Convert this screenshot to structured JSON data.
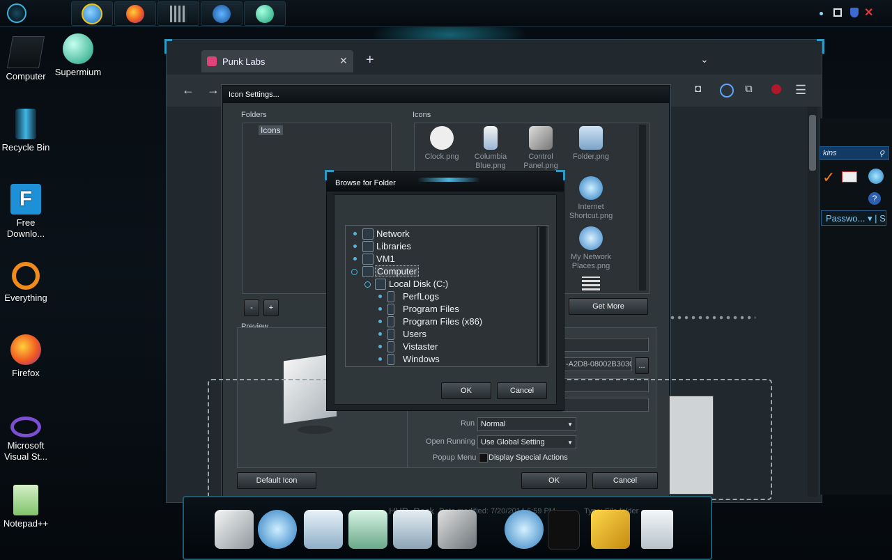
{
  "taskbar": {
    "apps": [
      "internet-explorer",
      "firefox",
      "film-strip",
      "media-player",
      "supermium"
    ],
    "tray_icons": [
      "restore-icon",
      "shield-icon",
      "close-icon"
    ]
  },
  "desktop": {
    "icons": [
      {
        "label": "Computer",
        "icon": "computer-icon"
      },
      {
        "label": "Supermium",
        "icon": "supermium-icon"
      },
      {
        "label": "Recycle Bin",
        "icon": "recycle-bin-icon"
      },
      {
        "label": "Free Downlo...",
        "icon": "free-download-manager-icon"
      },
      {
        "label": "Everything",
        "icon": "everything-search-icon"
      },
      {
        "label": "Firefox",
        "icon": "firefox-icon"
      },
      {
        "label": "Microsoft Visual St...",
        "icon": "visual-studio-icon"
      },
      {
        "label": "Notepad++",
        "icon": "notepadpp-icon"
      }
    ]
  },
  "browser": {
    "tab_title": "Punk Labs",
    "new_tab": "+",
    "side_panel": {
      "search_text": "kins",
      "password_label": "Passwo...",
      "extra_label": "Si"
    }
  },
  "icon_settings": {
    "title": "Icon Settings...",
    "folders_label": "Folders",
    "folder_items": [
      "Icons"
    ],
    "minus_label": "-",
    "plus_label": "+",
    "icons_label": "Icons",
    "icons": [
      {
        "label": "Clock.png",
        "icon": "clock-icon"
      },
      {
        "label": "Columbia Blue.png",
        "icon": "shuttle-icon"
      },
      {
        "label": "Control Panel.png",
        "icon": "control-panel-icon"
      },
      {
        "label": "Folder.png",
        "icon": "folder-icon"
      },
      {
        "label": "Internet Shortcut.png",
        "icon": "globe-icon"
      },
      {
        "label": "My Network Places.png",
        "icon": "network-places-icon"
      }
    ],
    "get_more_label": "Get More",
    "preview_label": "Preview",
    "guid_value": "-A2D8-08002B30309",
    "browse_dots": "...",
    "run_label": "Run",
    "run_value": "Normal",
    "open_running_label": "Open Running",
    "open_running_value": "Use Global Setting",
    "popup_menu_label": "Popup Menu",
    "popup_menu_checkbox": "Display Special Actions",
    "default_icon_label": "Default Icon",
    "ok_label": "OK",
    "cancel_label": "Cancel"
  },
  "browse_folder": {
    "title": "Browse for Folder",
    "tree": [
      {
        "label": "Network",
        "level": 0
      },
      {
        "label": "Libraries",
        "level": 0
      },
      {
        "label": "VM1",
        "level": 0
      },
      {
        "label": "Computer",
        "level": 0,
        "selected": true
      },
      {
        "label": "Local Disk (C:)",
        "level": 1
      },
      {
        "label": "PerfLogs",
        "level": 2
      },
      {
        "label": "Program Files",
        "level": 2
      },
      {
        "label": "Program Files (x86)",
        "level": 2
      },
      {
        "label": "Users",
        "level": 2
      },
      {
        "label": "Vistaster",
        "level": 2
      },
      {
        "label": "Windows",
        "level": 2
      }
    ],
    "ok_label": "OK",
    "cancel_label": "Cancel"
  },
  "dock": {
    "title": "HUD_Dock",
    "date_modified": "Date modified: 7/20/2014 6:59 PM",
    "type": "Type: File folder",
    "items": [
      "computer-icon",
      "internet-shortcut-icon",
      "documents-folder-icon",
      "music-folder-icon",
      "pictures-folder-icon",
      "control-panel-icon",
      "globe-icon",
      "ninja-icon",
      "tools-icon",
      "recycle-bin-icon"
    ]
  },
  "colors": {
    "accent": "#2d9ac4",
    "panel": "#30373b",
    "background": "#05090d"
  }
}
